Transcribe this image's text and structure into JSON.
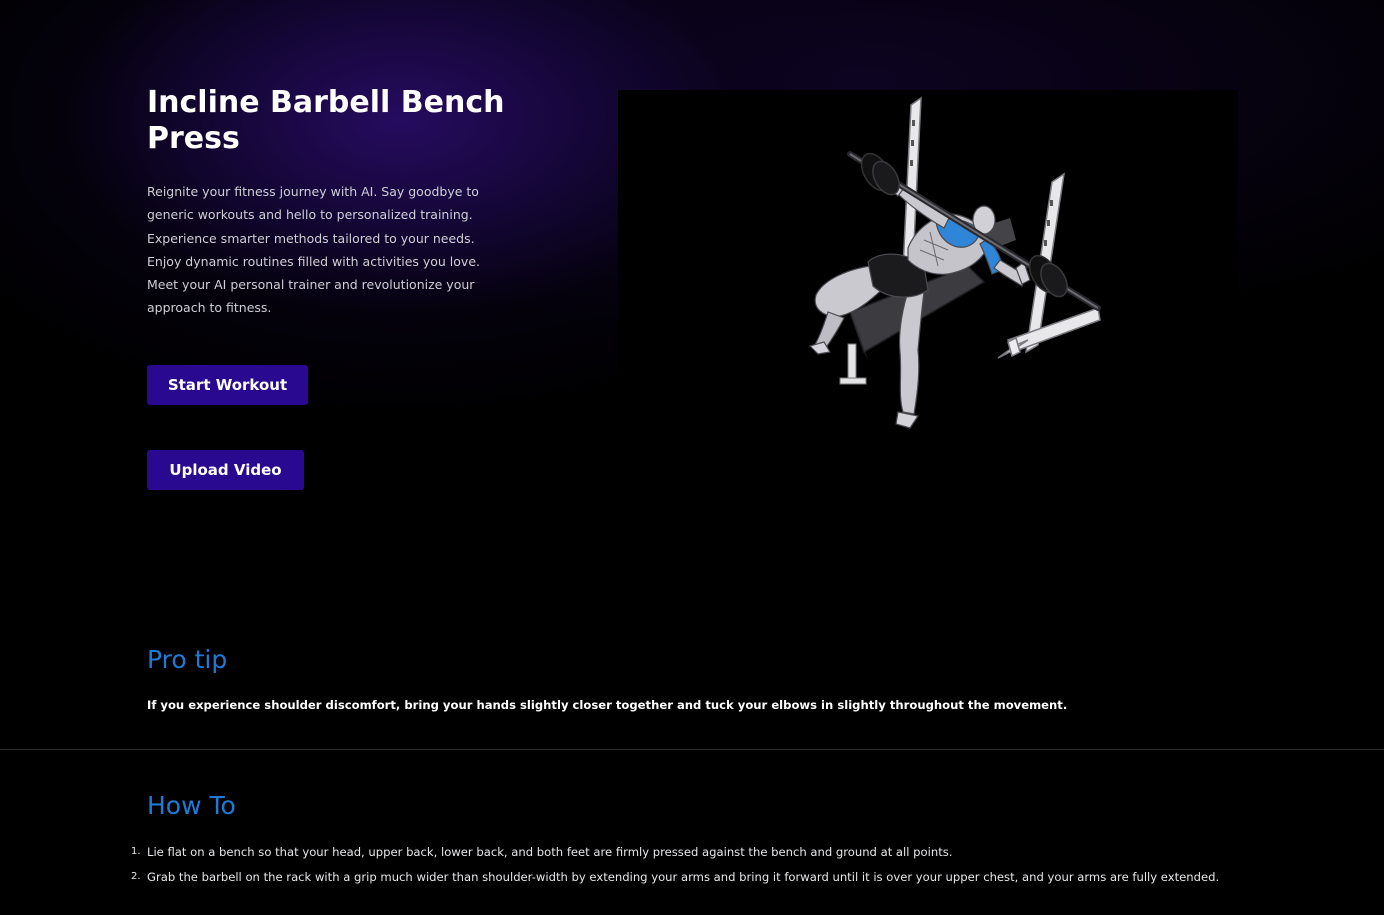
{
  "hero": {
    "title": "Incline Barbell Bench Press",
    "description": "Reignite your fitness journey with AI. Say goodbye to generic workouts and hello to personalized training. Experience smarter methods tailored to your needs. Enjoy dynamic routines filled with activities you love. Meet your AI personal trainer and revolutionize your approach to fitness.",
    "start_button": "Start Workout",
    "upload_button": "Upload Video",
    "image_icon": "bench-press-illustration"
  },
  "pro_tip": {
    "title": "Pro tip",
    "text": "If you experience shoulder discomfort, bring your hands slightly closer together and tuck your elbows in slightly throughout the movement."
  },
  "how_to": {
    "title": "How To",
    "steps": [
      {
        "num": "1.",
        "text": "Lie flat on a bench so that your head, upper back, lower back, and both feet are firmly pressed against the bench and ground at all points."
      },
      {
        "num": "2.",
        "text": "Grab the barbell on the rack with a grip much wider than shoulder-width by extending your arms and bring it forward until it is over your upper chest, and your arms are fully extended."
      }
    ]
  },
  "colors": {
    "background": "#000000",
    "button": "#2a0991",
    "section_title": "#1f7ad6",
    "glow": "#280c64",
    "muscle_highlight": "#2f86d8"
  }
}
